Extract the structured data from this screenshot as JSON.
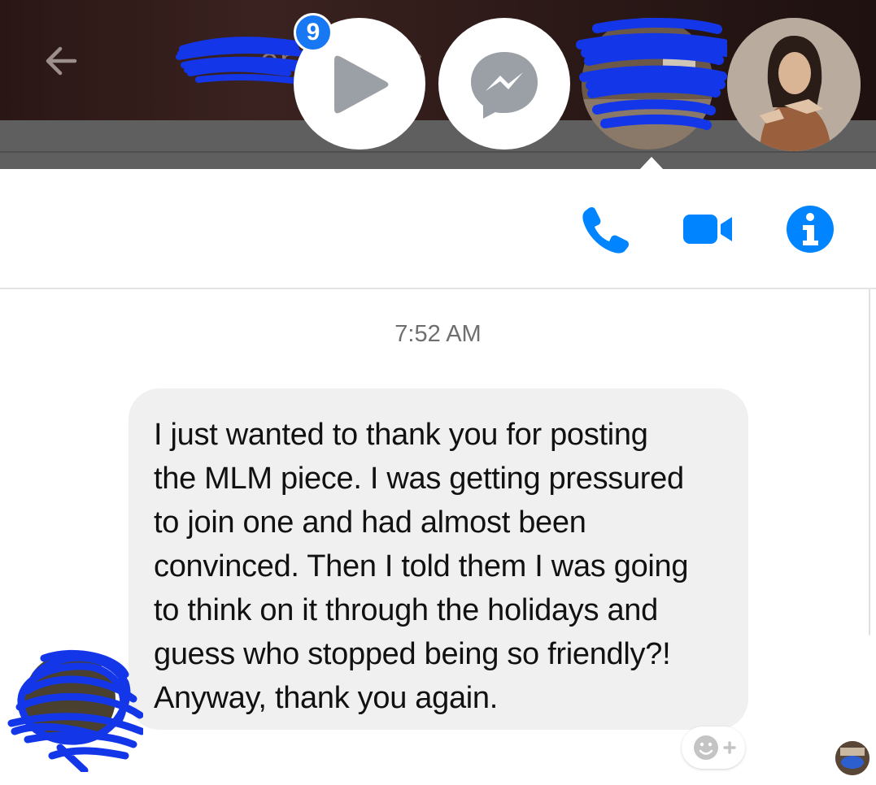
{
  "header": {
    "back_icon": "arrow-left-icon",
    "unread_badge": "9"
  },
  "chat_heads": [
    {
      "icon": "play-icon",
      "name": "video-chathead"
    },
    {
      "icon": "messenger-icon",
      "name": "messenger-chathead"
    },
    {
      "icon": "contact-avatar",
      "name": "contact-chathead"
    },
    {
      "icon": "profile-avatar",
      "name": "profile-chathead"
    }
  ],
  "toolbar": {
    "phone_icon": "phone-icon",
    "video_icon": "video-camera-icon",
    "info_icon": "info-icon"
  },
  "conversation": {
    "timestamp": "7:52 AM",
    "messages": [
      {
        "text": "I just wanted to thank you for posting\nthe MLM piece. I was getting pressured\nto join one and had almost been\nconvinced. Then I told them I was going\nto think on it through the holidays and\nguess who stopped being so friendly?!\nAnyway, thank you again."
      }
    ],
    "react_icon": "emoji-add-icon"
  },
  "colors": {
    "accent": "#0084ff",
    "badge": "#1877f2",
    "bubble": "#f0f0f0",
    "scribble": "#1337e8",
    "dim_overlay": "#5f5f5f"
  }
}
